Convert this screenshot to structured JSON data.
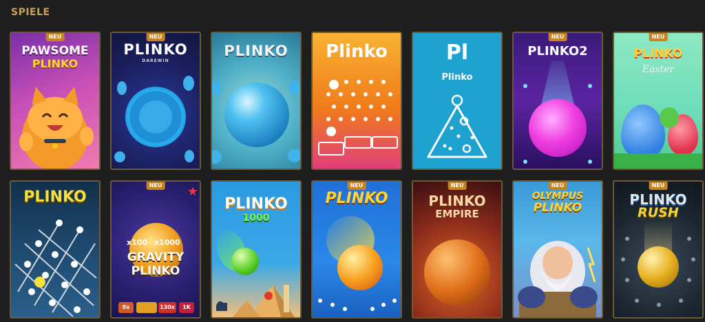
{
  "section_title": "SPIELE",
  "badge_label": "NEU",
  "cards": [
    {
      "title": "PAWSOME",
      "subtitle": "PLINKO",
      "badge": true
    },
    {
      "title": "PLINKO",
      "subtitle": "DAREWIN",
      "badge": true
    },
    {
      "title": "PLINKO",
      "badge": false
    },
    {
      "title": "Plinko",
      "badge": false
    },
    {
      "title": "Pl",
      "subtitle": "Plinko",
      "badge": false
    },
    {
      "title": "PLINKO2",
      "badge": true
    },
    {
      "title": "PLINKO",
      "subtitle": "Easter",
      "badge": true
    },
    {
      "title": "PLINKO",
      "badge": false
    },
    {
      "title": "GRAVITY",
      "subtitle": "PLINKO",
      "badge": true,
      "multipliers": [
        "x100",
        "x1000"
      ],
      "chips": [
        "9x",
        "130x",
        "1K"
      ]
    },
    {
      "title": "PLINKO",
      "subtitle": "1000",
      "badge": false
    },
    {
      "title": "PLINKO",
      "badge": true
    },
    {
      "title": "PLINKO",
      "subtitle": "EMPIRE",
      "badge": true
    },
    {
      "title": "OLYMPUS",
      "subtitle": "PLINKO",
      "badge": true
    },
    {
      "title": "PLINKO",
      "subtitle": "RUSH",
      "badge": true
    }
  ]
}
